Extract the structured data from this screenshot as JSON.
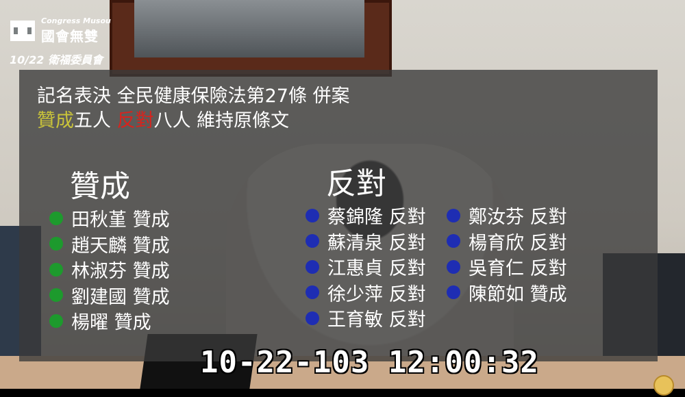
{
  "logo": {
    "english": "Congress Musou",
    "chinese": "國會無雙"
  },
  "meeting": "10/22 衛福委員會",
  "title": "記名表決 全民健康保險法第27條 併案",
  "result": {
    "yes_word": "贊成",
    "yes_count": "五人 ",
    "no_word": "反對",
    "no_count": "八人 維持原條文"
  },
  "yes_section": {
    "heading": "贊成",
    "votes": [
      "田秋堇 贊成",
      "趙天麟 贊成",
      "林淑芬 贊成",
      "劉建國 贊成",
      "楊曜 贊成"
    ]
  },
  "no_section": {
    "heading": "反對",
    "column1": [
      "蔡錦隆 反對",
      "蘇清泉 反對",
      "江惠貞 反對",
      "徐少萍 反對",
      "王育敏 反對"
    ],
    "column2": [
      "鄭汝芬 反對",
      "楊育欣 反對",
      "吳育仁 反對",
      "陳節如 贊成"
    ]
  },
  "timestamp": "10-22-103 12:00:32",
  "colors": {
    "yes_accent": "#c9c33a",
    "no_accent": "#d8231d",
    "yes_dot": "#1d9a2d",
    "no_dot": "#1e2db3"
  }
}
